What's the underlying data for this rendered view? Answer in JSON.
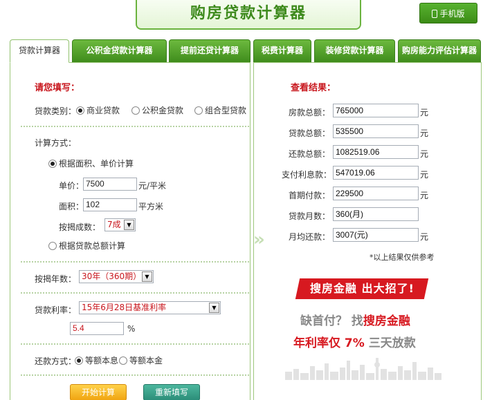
{
  "header": {
    "title": "购房贷款计算器",
    "mobile_label": "手机版"
  },
  "tabs": [
    {
      "label": "贷款计算器",
      "active": true
    },
    {
      "label": "公积金贷款计算器",
      "active": false
    },
    {
      "label": "提前还贷计算器",
      "active": false
    },
    {
      "label": "税费计算器",
      "active": false
    },
    {
      "label": "装修贷款计算器",
      "active": false
    },
    {
      "label": "购房能力评估计算器",
      "active": false
    }
  ],
  "form": {
    "section_title": "请您填写：",
    "loan_type_label": "贷款类别：",
    "loan_types": [
      "商业贷款",
      "公积金贷款",
      "组合型贷款"
    ],
    "calc_method_label": "计算方式：",
    "method_area": "根据面积、单价计算",
    "price_label": "单价：",
    "price_value": "7500",
    "price_unit": "元/平米",
    "area_label": "面积：",
    "area_value": "102",
    "area_unit": "平方米",
    "ratio_label": "按揭成数：",
    "ratio_value": "7成",
    "method_total": "根据贷款总额计算",
    "years_label": "按揭年数：",
    "years_value": "30年（360期）",
    "rate_label": "贷款利率：",
    "rate_value": "15年6月28日基准利率",
    "rate_input": "5.4",
    "rate_unit": "%",
    "repay_label": "还款方式：",
    "repay_options": [
      "等额本息",
      "等额本金"
    ],
    "start_button": "开始计算",
    "reset_button": "重新填写"
  },
  "results": {
    "section_title": "查看结果：",
    "rows": [
      {
        "label": "房款总额：",
        "value": "765000",
        "unit": "元"
      },
      {
        "label": "贷款总额：",
        "value": "535500",
        "unit": "元"
      },
      {
        "label": "还款总额：",
        "value": "1082519.06",
        "unit": "元"
      },
      {
        "label": "支付利息款：",
        "value": "547019.06",
        "unit": "元"
      },
      {
        "label": "首期付款：",
        "value": "229500",
        "unit": "元"
      },
      {
        "label": "贷款月数：",
        "value": "360(月)",
        "unit": ""
      },
      {
        "label": "月均还款：",
        "value": "3007(元)",
        "unit": "元"
      }
    ],
    "note": "*以上结果仅供参考"
  },
  "ad": {
    "banner": "搜房金融  出大招了!",
    "line1_a": "缺首付？ 找",
    "line1_b": "搜房金融",
    "line2_a": "年利率仅 7%",
    "line2_b": " 三天放款"
  },
  "colors": {
    "brand_green": "#4e9f26",
    "accent_red": "#c8161d",
    "start_orange": "#f0a512",
    "reset_teal": "#2c8e79"
  }
}
